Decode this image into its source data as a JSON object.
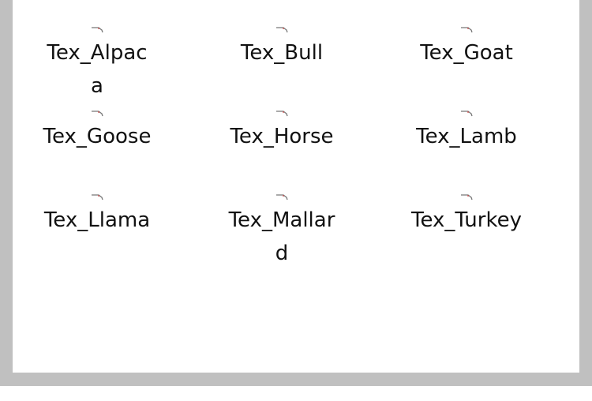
{
  "window": {
    "frame_color": "#c0c0c0",
    "pane_color": "#ffffff"
  },
  "files": [
    {
      "label": "Tex_Alpaca",
      "icon": "file-icon"
    },
    {
      "label": "Tex_Bull",
      "icon": "file-icon"
    },
    {
      "label": "Tex_Goat",
      "icon": "file-icon"
    },
    {
      "label": "Tex_Goose",
      "icon": "file-icon"
    },
    {
      "label": "Tex_Horse",
      "icon": "file-icon"
    },
    {
      "label": "Tex_Lamb",
      "icon": "file-icon"
    },
    {
      "label": "Tex_Llama",
      "icon": "file-icon"
    },
    {
      "label": "Tex_Mallard",
      "icon": "file-icon"
    },
    {
      "label": "Tex_Turkey",
      "icon": "file-icon"
    }
  ]
}
